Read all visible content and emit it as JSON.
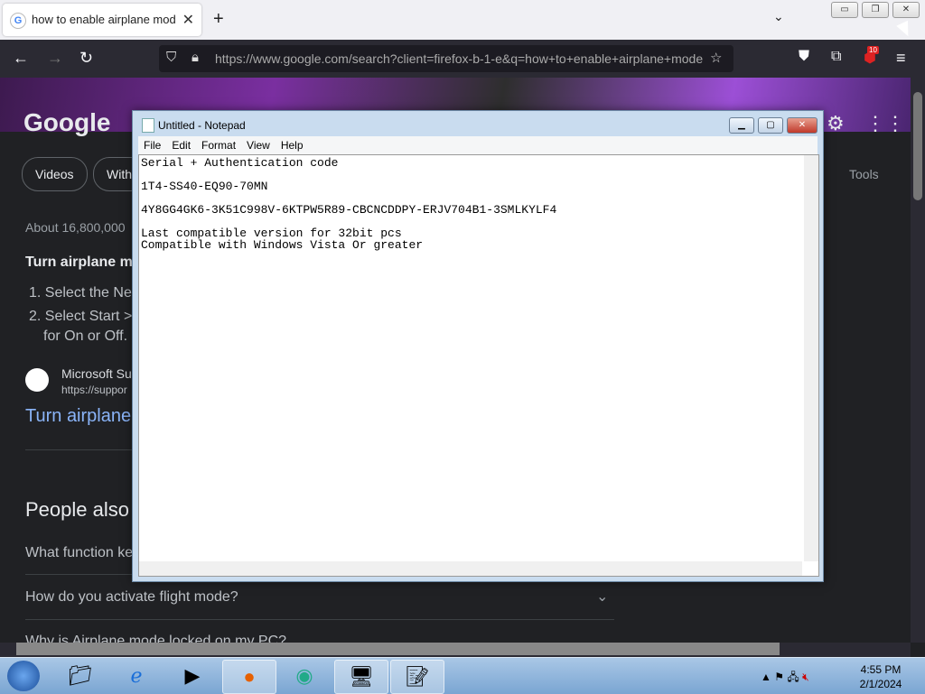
{
  "browser": {
    "tab_title": "how to enable airplane mode in",
    "url": "https://www.google.com/search?client=firefox-b-1-e&q=how+to+enable+airplane+mode",
    "badge_count": "10"
  },
  "google": {
    "logo": "Google",
    "chips": [
      "Videos",
      "With"
    ],
    "tools": "Tools",
    "result_count": "About 16,800,000",
    "heading": "Turn airplane m",
    "steps": [
      "1. Select the Ne",
      "2. Select Start >",
      "for On or Off."
    ],
    "source_name": "Microsoft Su",
    "source_url": "https://suppor",
    "link_title": "Turn airplane",
    "people_also": "People also",
    "questions": [
      "What function ke",
      "How do you activate flight mode?",
      "Why is Airplane mode locked on my PC?"
    ]
  },
  "notepad": {
    "title": "Untitled - Notepad",
    "menu": [
      "File",
      "Edit",
      "Format",
      "View",
      "Help"
    ],
    "content": "Serial + Authentication code\n\n1T4-SS40-EQ90-70MN\n\n4Y8GG4GK6-3K51C998V-6KTPW5R89-CBCNCDDPY-ERJV704B1-3SMLKYLF4\n\nLast compatible version for 32bit pcs\nCompatible with Windows Vista Or greater"
  },
  "taskbar": {
    "time": "4:55 PM",
    "date": "2/1/2024"
  }
}
